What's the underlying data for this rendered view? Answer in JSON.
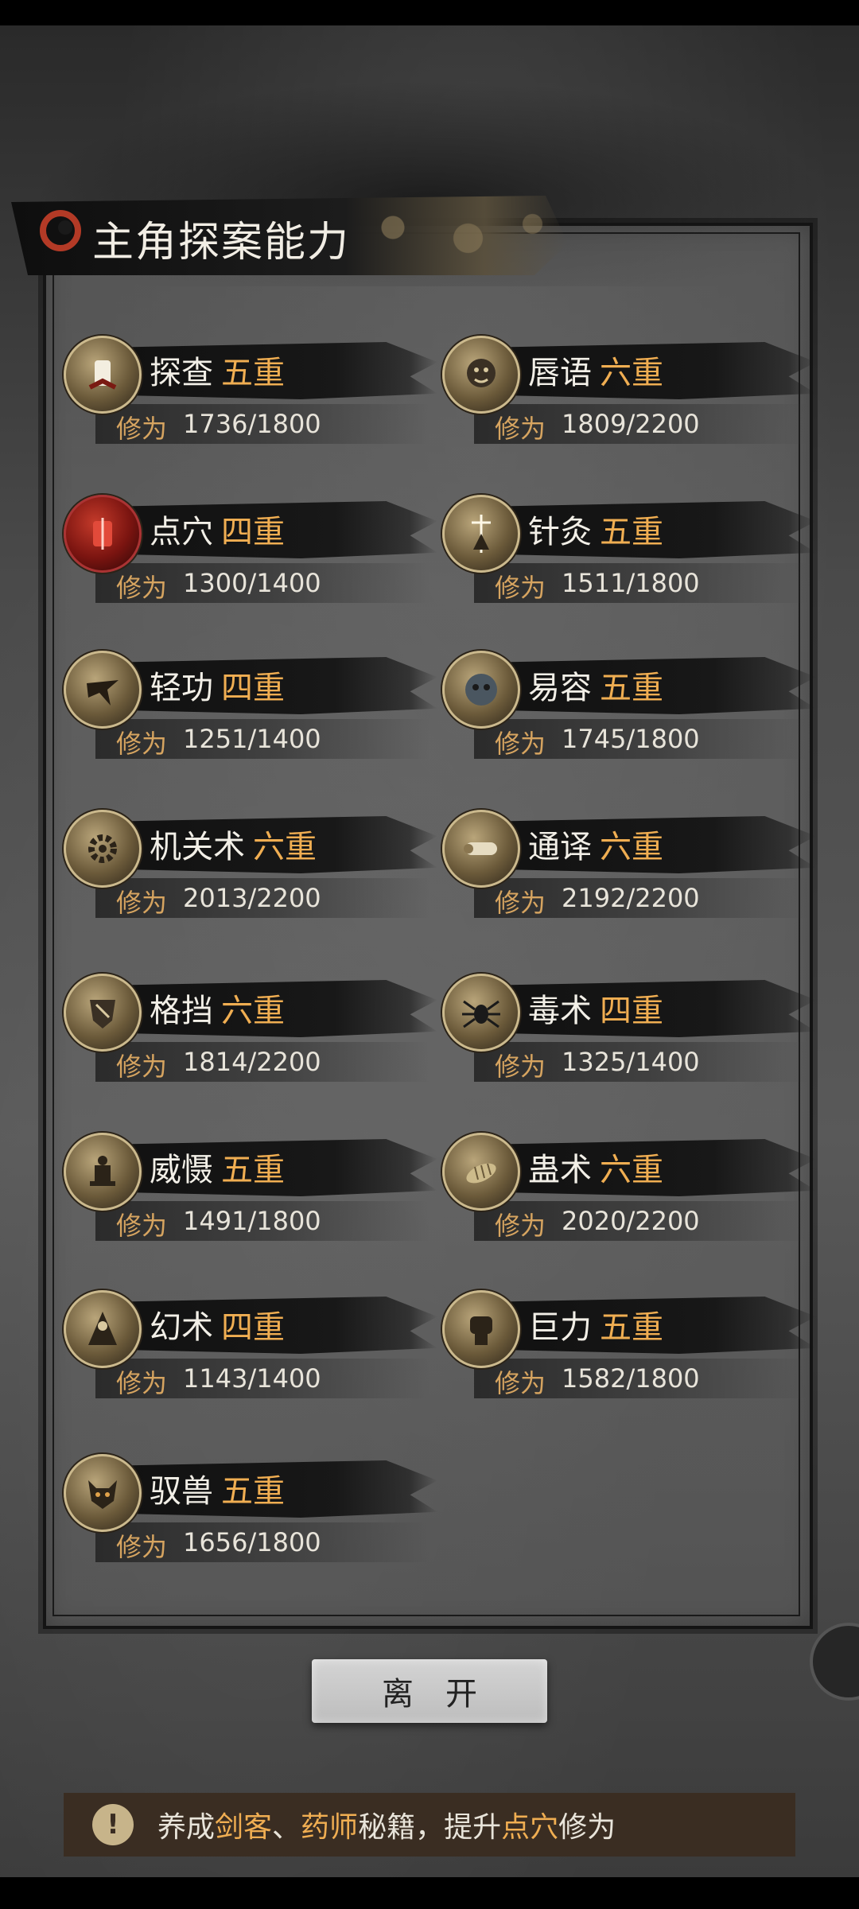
{
  "header": {
    "title": "主角探案能力"
  },
  "labels": {
    "xiuwei": "修为"
  },
  "abilities": [
    {
      "name": "探查",
      "level": "五重",
      "progress": "1736/1800",
      "icon": "lantern-icon"
    },
    {
      "name": "唇语",
      "level": "六重",
      "progress": "1809/2200",
      "icon": "mask-face-icon"
    },
    {
      "name": "点穴",
      "level": "四重",
      "progress": "1300/1400",
      "icon": "acupoint-icon",
      "highlight": "red"
    },
    {
      "name": "针灸",
      "level": "五重",
      "progress": "1511/1800",
      "icon": "needle-icon"
    },
    {
      "name": "轻功",
      "level": "四重",
      "progress": "1251/1400",
      "icon": "leaping-figure-icon"
    },
    {
      "name": "易容",
      "level": "五重",
      "progress": "1745/1800",
      "icon": "disguise-mask-icon"
    },
    {
      "name": "机关术",
      "level": "六重",
      "progress": "2013/2200",
      "icon": "gear-icon"
    },
    {
      "name": "通译",
      "level": "六重",
      "progress": "2192/2200",
      "icon": "scroll-icon"
    },
    {
      "name": "格挡",
      "level": "六重",
      "progress": "1814/2200",
      "icon": "shield-icon"
    },
    {
      "name": "毒术",
      "level": "四重",
      "progress": "1325/1400",
      "icon": "spider-icon"
    },
    {
      "name": "威慑",
      "level": "五重",
      "progress": "1491/1800",
      "icon": "warrior-statue-icon"
    },
    {
      "name": "蛊术",
      "level": "六重",
      "progress": "2020/2200",
      "icon": "larva-icon"
    },
    {
      "name": "幻术",
      "level": "四重",
      "progress": "1143/1400",
      "icon": "hooded-figure-icon"
    },
    {
      "name": "巨力",
      "level": "五重",
      "progress": "1582/1800",
      "icon": "fist-icon"
    },
    {
      "name": "驭兽",
      "level": "五重",
      "progress": "1656/1800",
      "icon": "wolf-head-icon"
    }
  ],
  "leave_button": {
    "label": "离开"
  },
  "tip": {
    "prefix": "养成",
    "hl1": "剑客",
    "sep": "、",
    "hl2": "药师",
    "middle": "秘籍，提升",
    "hl3": "点穴",
    "suffix": "修为"
  },
  "colors": {
    "accent": "#f0ae52",
    "text": "#f2efe7",
    "label": "#d6a460"
  }
}
